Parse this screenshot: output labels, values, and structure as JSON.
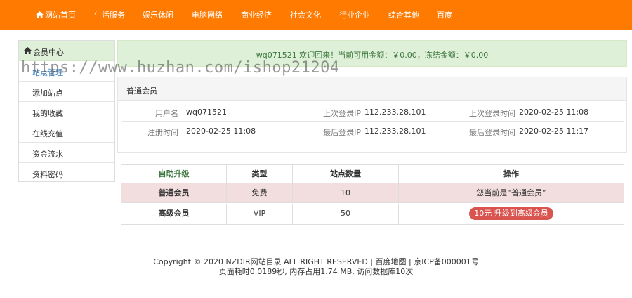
{
  "nav": {
    "items": [
      "网站首页",
      "生活服务",
      "娱乐休闲",
      "电脑网络",
      "商业经济",
      "社会文化",
      "行业企业",
      "综合其他",
      "百度"
    ],
    "icon": "home-icon",
    "color": "#ff7a00"
  },
  "sidebar": {
    "title": "会员中心",
    "icon": "home-icon",
    "items": [
      "站点管理",
      "添加站点",
      "我的收藏",
      "在线充值",
      "资金流水",
      "资料密码"
    ]
  },
  "alert": {
    "text": "wq071521   欢迎回来！当前可用金额：￥0.00，冻结金额：￥0.00"
  },
  "member_panel": {
    "title": "普通会员",
    "rows": [
      [
        {
          "label": "用户名",
          "value": "wq071521"
        },
        {
          "label": "上次登录IP",
          "value": "112.233.28.101"
        },
        {
          "label": "上次登录时间",
          "value": "2020-02-25 11:08"
        }
      ],
      [
        {
          "label": "注册时间",
          "value": "2020-02-25 11:08"
        },
        {
          "label": "最后登录IP",
          "value": "112.233.28.101"
        },
        {
          "label": "最后登录时间",
          "value": "2020-02-25 11:17"
        }
      ]
    ]
  },
  "upgrade_table": {
    "headers": [
      "自助升级",
      "类型",
      "站点数量",
      "操作"
    ],
    "rows": [
      {
        "name": "普通会员",
        "type": "免费",
        "sites": "10",
        "action": "您当前是“普通会员”"
      },
      {
        "name": "高级会员",
        "type": "VIP",
        "sites": "50",
        "action_button": "10元 升级到高级会员"
      }
    ]
  },
  "footer": {
    "line1": "Copyright © 2020 NZDIR网站目录 ALL RIGHT RESERVED | 百度地图 | 京ICP备000001号",
    "line2": "页面耗时0.0189秒, 内存占用1.74 MB, 访问数据库10次"
  },
  "watermark": "https://www.huzhan.com/ishop21204"
}
